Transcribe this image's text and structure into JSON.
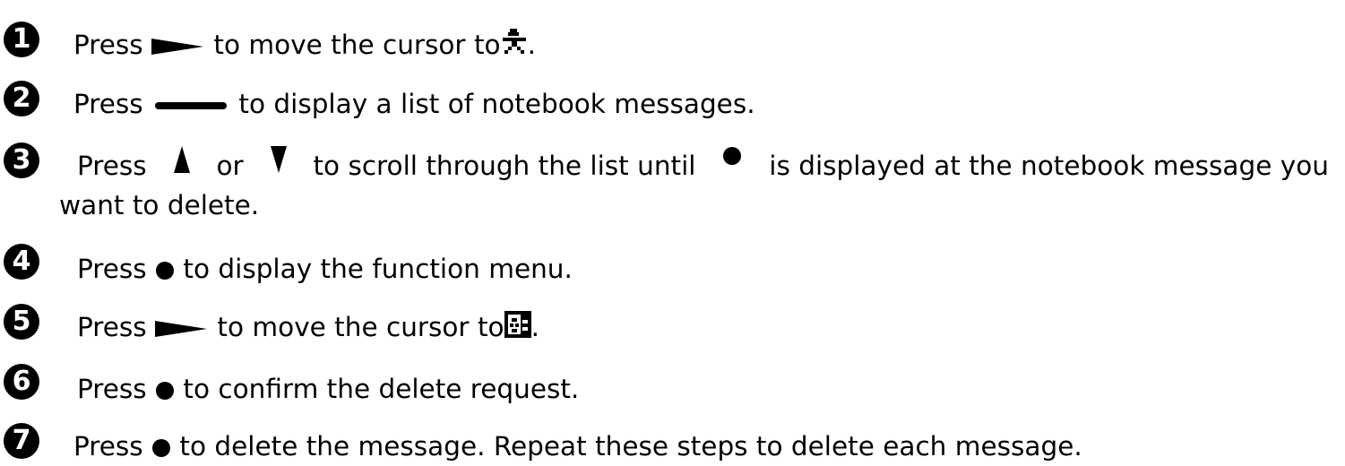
{
  "icons": {
    "right_arrow": "right-arrow-key-icon",
    "center_key": "long-center-key-icon",
    "up_arrow": "up-arrow-key-icon",
    "down_arrow": "down-arrow-key-icon",
    "bullet": "round-select-button-icon",
    "person": "person-pixel-icon",
    "delete": "delete-pixel-icon"
  },
  "steps": [
    {
      "number": "1",
      "t1": "Press",
      "t2": "to move the cursor to",
      "t3": "."
    },
    {
      "number": "2",
      "t1": "Press",
      "t2": "to display a list of notebook messages."
    },
    {
      "number": "3",
      "t1": "Press",
      "t2": "or",
      "t3": "to scroll through the list until",
      "t4": "is displayed at the notebook message you",
      "t5": "want to delete."
    },
    {
      "number": "4",
      "t1": "Press",
      "t2": "to display the function menu."
    },
    {
      "number": "5",
      "t1": "Press",
      "t2": "to move the cursor to",
      "t3": "."
    },
    {
      "number": "6",
      "t1": "Press",
      "t2": "to confirm the delete request."
    },
    {
      "number": "7",
      "t1": "Press",
      "t2": "to delete the message. Repeat these steps to delete each message."
    }
  ]
}
